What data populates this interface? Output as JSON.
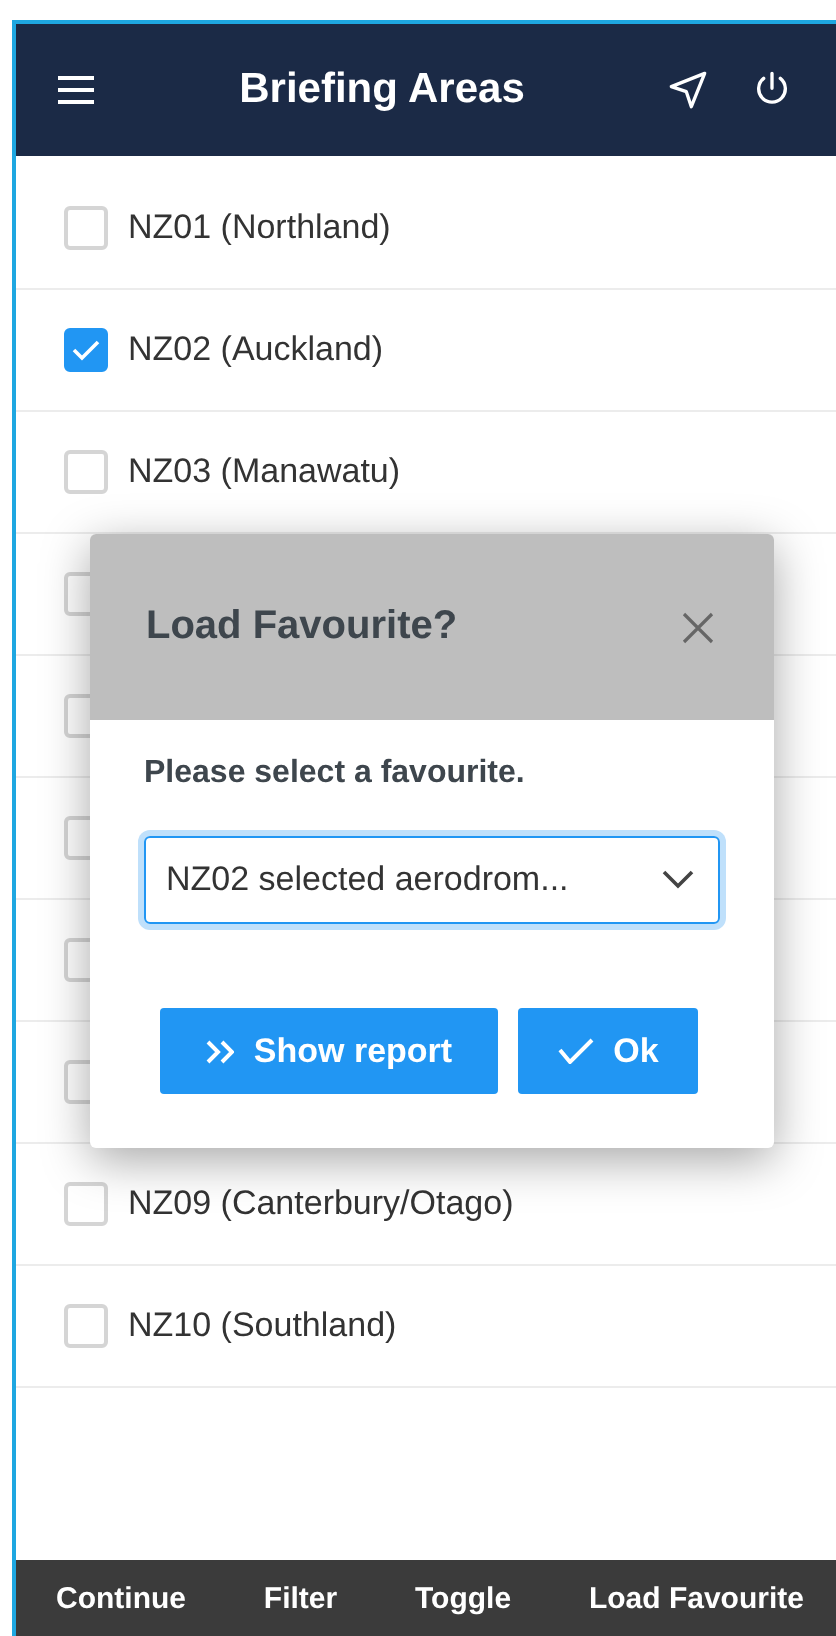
{
  "header": {
    "title": "Briefing Areas"
  },
  "areas": [
    {
      "label": "NZ01 (Northland)",
      "checked": false
    },
    {
      "label": "NZ02 (Auckland)",
      "checked": true
    },
    {
      "label": "NZ03 (Manawatu)",
      "checked": false
    },
    {
      "checked": false
    },
    {
      "checked": false
    },
    {
      "checked": false
    },
    {
      "checked": false
    },
    {
      "checked": false
    },
    {
      "label": "NZ09 (Canterbury/Otago)",
      "checked": false
    },
    {
      "label": "NZ10 (Southland)",
      "checked": false
    }
  ],
  "dialog": {
    "title": "Load Favourite?",
    "prompt": "Please select a favourite.",
    "select_value": "NZ02 selected aerodrom...",
    "buttons": [
      {
        "kind": "report",
        "label": "Show report"
      },
      {
        "kind": "ok",
        "label": "Ok"
      }
    ]
  },
  "bottom_bar": [
    "Continue",
    "Filter",
    "Toggle",
    "Load Favourite"
  ]
}
